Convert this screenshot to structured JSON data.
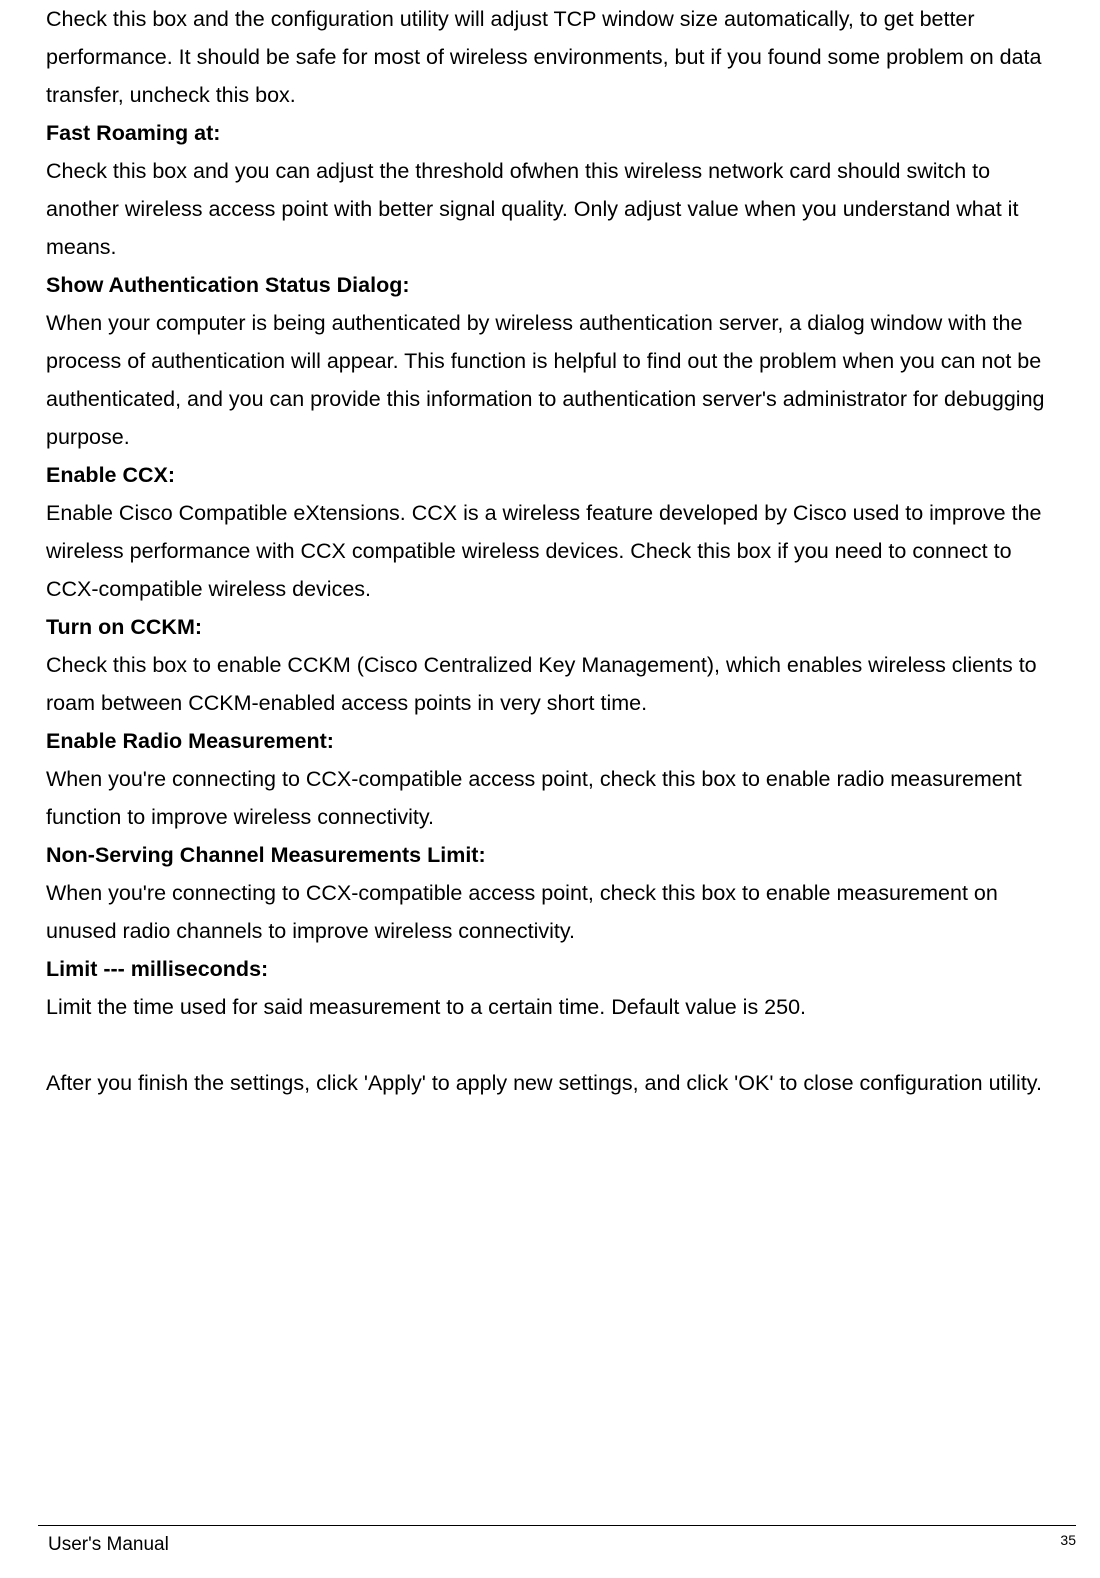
{
  "body": {
    "p0": "Check this box and the configuration utility will adjust TCP window size automatically, to get better performance. It should be safe for most of wireless environments, but if you found some problem on data transfer, uncheck this box.",
    "h1": "Fast Roaming at:",
    "p1": "Check this box and you can adjust the threshold ofwhen this wireless network card should switch to another wireless access point with better signal quality. Only adjust value when you understand what it means.",
    "h2": "Show Authentication Status Dialog:",
    "p2": "When your computer is being authenticated by wireless authentication server, a dialog window with the process of authentication will appear. This function is helpful to find out the problem when you can not be authenticated, and you can provide this information to authentication server's administrator for debugging purpose.",
    "h3": "Enable CCX:",
    "p3": "Enable Cisco Compatible eXtensions. CCX is a wireless feature developed by Cisco used to improve the wireless performance with CCX compatible wireless devices. Check this box if you need to connect to CCX-compatible wireless devices.",
    "h4": "Turn on CCKM:",
    "p4": "Check this box to enable CCKM (Cisco Centralized Key Management), which enables wireless clients to roam between CCKM-enabled access points in very short time.",
    "h5": "Enable Radio Measurement:",
    "p5": "When you're connecting to CCX-compatible access point, check this box to enable radio measurement function to improve wireless connectivity.",
    "h6": "Non-Serving Channel Measurements Limit:",
    "p6": "When you're connecting to CCX-compatible access point, check this box to enable measurement on unused radio channels to improve wireless connectivity.",
    "h7": "Limit --- milliseconds:",
    "p7": "Limit the time used for said measurement to a certain time. Default value is 250.",
    "p8": "After you finish the settings, click 'Apply' to apply new settings, and click 'OK' to close configuration utility."
  },
  "footer": {
    "left": "User's Manual",
    "right": "35"
  }
}
